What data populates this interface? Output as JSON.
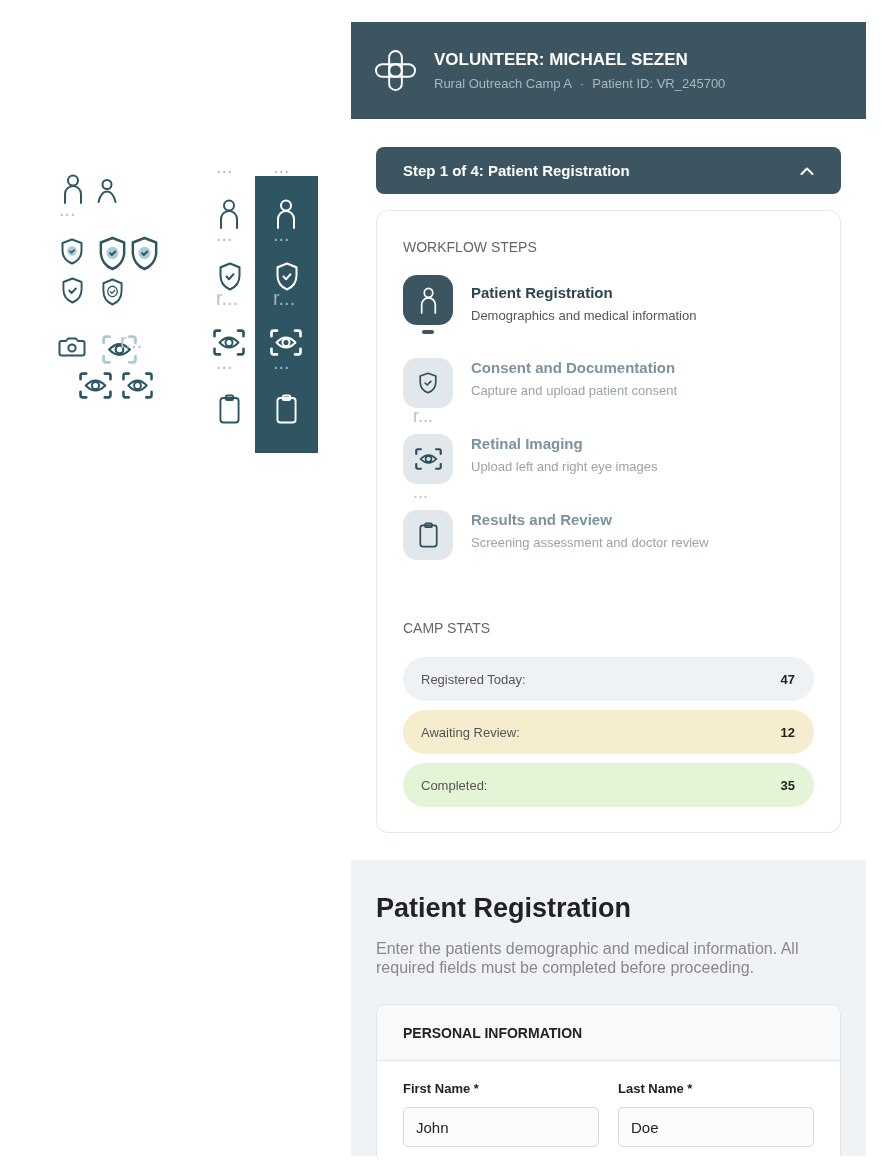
{
  "icon_sheet": {
    "captions": [
      "...",
      "r..."
    ],
    "columns": [
      {
        "kind": "light",
        "captions": [
          "...",
          "...",
          "r...",
          "..."
        ]
      },
      {
        "kind": "dark",
        "captions": [
          "...",
          "...",
          "r...",
          "..."
        ]
      }
    ]
  },
  "header": {
    "title": "VOLUNTEER: MICHAEL SEZEN",
    "location": "Rural Outreach Camp A",
    "separator": "·",
    "patient_id": "Patient ID: VR_245700"
  },
  "step_bar": {
    "label": "Step 1 of 4: Patient Registration",
    "expanded": true
  },
  "workflow": {
    "title": "WORKFLOW STEPS",
    "steps": [
      {
        "title": "Patient Registration",
        "description": "Demographics and medical information",
        "selected": true
      },
      {
        "title": "Consent and Documentation",
        "description": "Capture and upload patient consent",
        "selected": false,
        "trail": "r..."
      },
      {
        "title": "Retinal Imaging",
        "description": "Upload left and right eye images",
        "selected": false,
        "trail": "..."
      },
      {
        "title": "Results and Review",
        "description": "Screening assessment and doctor review",
        "selected": false
      }
    ]
  },
  "camp_stats": {
    "title": "CAMP STATS",
    "items": [
      {
        "label": "Registered Today:",
        "value": "47",
        "color": "#eef2f5"
      },
      {
        "label": "Awaiting Review:",
        "value": "12",
        "color": "#f6edcf"
      },
      {
        "label": "Completed:",
        "value": "35",
        "color": "#e4f5d7"
      }
    ]
  },
  "registration": {
    "title": "Patient Registration",
    "description": "Enter the patients demographic and medical information. All required fields must be completed before proceeding.",
    "section": {
      "title": "PERSONAL INFORMATION",
      "fields": [
        {
          "label": "First Name *",
          "value": "John"
        },
        {
          "label": "Last Name *",
          "value": "Doe"
        }
      ]
    }
  }
}
